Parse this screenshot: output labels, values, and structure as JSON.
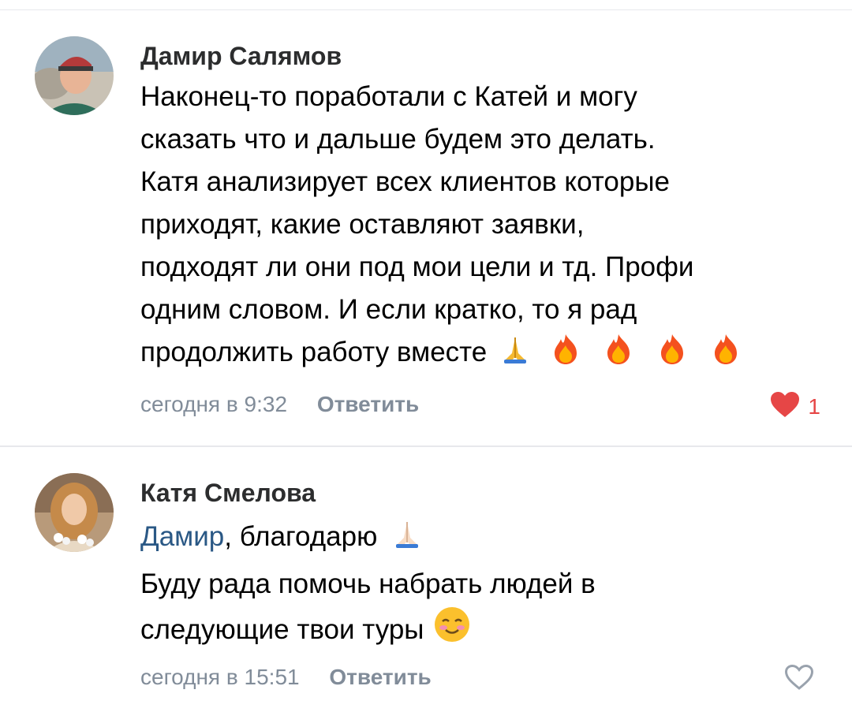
{
  "comments": [
    {
      "author": "Дамир Салямов",
      "lines": [
        "Наконец-то поработали с Катей и могу",
        "сказать что и дальше будем это делать.",
        "Катя анализирует всех клиентов которые",
        "приходят, какие оставляют заявки,",
        "подходят ли они под мои цели и тд. Профи",
        "одним словом. И если кратко, то я рад",
        "продолжить работу вместе"
      ],
      "emoji_icons": [
        "folded-hands-icon",
        "fire-icon",
        "fire-icon",
        "fire-icon",
        "fire-icon"
      ],
      "date": "сегодня в 9:32",
      "reply_label": "Ответить",
      "likes": "1",
      "liked": true
    },
    {
      "author": "Катя Смелова",
      "mention": "Дамир",
      "first_line_rest": ", благодарю",
      "lines": [
        "Буду рада помочь набрать людей в",
        "следующие твои туры"
      ],
      "date": "сегодня в 15:51",
      "reply_label": "Ответить",
      "liked": false
    }
  ],
  "colors": {
    "author": "#2c2d2e",
    "meta": "#818c99",
    "mention": "#2a5885",
    "like": "#e64646",
    "divider": "#e7e8ec"
  }
}
